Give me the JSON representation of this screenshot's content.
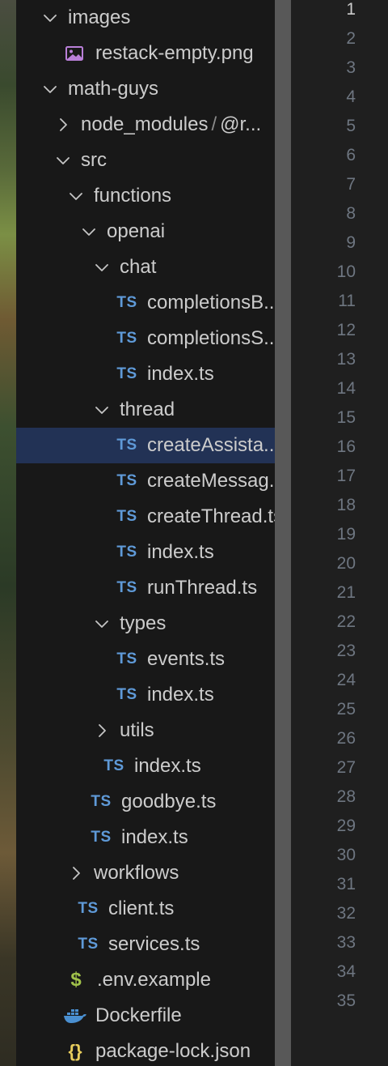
{
  "explorer": {
    "items": [
      {
        "label": "images",
        "kind": "folder",
        "expanded": true,
        "depth": 0,
        "icon": "chevron-down-icon"
      },
      {
        "label": "restack-empty.png",
        "kind": "image",
        "depth": 1,
        "icon": "image-file-icon"
      },
      {
        "label": "math-guys",
        "kind": "folder",
        "expanded": true,
        "depth": 0,
        "icon": "chevron-down-icon"
      },
      {
        "label": "node_modules",
        "label2": "@r...",
        "kind": "folder",
        "expanded": false,
        "depth": 1,
        "icon": "chevron-right-icon"
      },
      {
        "label": "src",
        "kind": "folder",
        "expanded": true,
        "depth": 1,
        "icon": "chevron-down-icon"
      },
      {
        "label": "functions",
        "kind": "folder",
        "expanded": true,
        "depth": 2,
        "icon": "chevron-down-icon"
      },
      {
        "label": "openai",
        "kind": "folder",
        "expanded": true,
        "depth": 3,
        "icon": "chevron-down-icon"
      },
      {
        "label": "chat",
        "kind": "folder",
        "expanded": true,
        "depth": 4,
        "icon": "chevron-down-icon"
      },
      {
        "label": "completionsB...",
        "kind": "ts",
        "depth": 5,
        "icon": "typescript-file-icon"
      },
      {
        "label": "completionsS...",
        "kind": "ts",
        "depth": 5,
        "icon": "typescript-file-icon"
      },
      {
        "label": "index.ts",
        "kind": "ts",
        "depth": 5,
        "icon": "typescript-file-icon"
      },
      {
        "label": "thread",
        "kind": "folder",
        "expanded": true,
        "depth": 4,
        "icon": "chevron-down-icon"
      },
      {
        "label": "createAssista...",
        "kind": "ts",
        "depth": 5,
        "selected": true,
        "icon": "typescript-file-icon"
      },
      {
        "label": "createMessag...",
        "kind": "ts",
        "depth": 5,
        "icon": "typescript-file-icon"
      },
      {
        "label": "createThread.ts",
        "kind": "ts",
        "depth": 5,
        "icon": "typescript-file-icon"
      },
      {
        "label": "index.ts",
        "kind": "ts",
        "depth": 5,
        "icon": "typescript-file-icon"
      },
      {
        "label": "runThread.ts",
        "kind": "ts",
        "depth": 5,
        "icon": "typescript-file-icon"
      },
      {
        "label": "types",
        "kind": "folder",
        "expanded": true,
        "depth": 4,
        "icon": "chevron-down-icon"
      },
      {
        "label": "events.ts",
        "kind": "ts",
        "depth": 5,
        "icon": "typescript-file-icon"
      },
      {
        "label": "index.ts",
        "kind": "ts",
        "depth": 5,
        "icon": "typescript-file-icon"
      },
      {
        "label": "utils",
        "kind": "folder",
        "expanded": false,
        "depth": 4,
        "icon": "chevron-right-icon"
      },
      {
        "label": "index.ts",
        "kind": "ts",
        "depth": 4,
        "icon": "typescript-file-icon"
      },
      {
        "label": "goodbye.ts",
        "kind": "ts",
        "depth": 3,
        "icon": "typescript-file-icon"
      },
      {
        "label": "index.ts",
        "kind": "ts",
        "depth": 3,
        "icon": "typescript-file-icon"
      },
      {
        "label": "workflows",
        "kind": "folder",
        "expanded": false,
        "depth": 2,
        "icon": "chevron-right-icon"
      },
      {
        "label": "client.ts",
        "kind": "ts",
        "depth": 2,
        "icon": "typescript-file-icon"
      },
      {
        "label": "services.ts",
        "kind": "ts",
        "depth": 2,
        "icon": "typescript-file-icon"
      },
      {
        "label": ".env.example",
        "kind": "env",
        "depth": 1,
        "icon": "dollar-env-icon"
      },
      {
        "label": "Dockerfile",
        "kind": "docker",
        "depth": 1,
        "icon": "docker-icon"
      },
      {
        "label": "package-lock.json",
        "kind": "json",
        "depth": 1,
        "icon": "json-braces-icon"
      }
    ],
    "ts_badge": "TS",
    "dollar_glyph": "$",
    "braces_glyph": "{}",
    "separator": "/"
  },
  "editor": {
    "line_numbers": [
      "1",
      "2",
      "3",
      "4",
      "5",
      "6",
      "7",
      "8",
      "9",
      "10",
      "11",
      "12",
      "13",
      "14",
      "15",
      "16",
      "17",
      "18",
      "19",
      "20",
      "21",
      "22",
      "23",
      "24",
      "25",
      "26",
      "27",
      "28",
      "29",
      "30",
      "31",
      "32",
      "33",
      "34",
      "35"
    ],
    "active_line": "1"
  },
  "colors": {
    "explorer_bg": "#181818",
    "selection_bg": "#223255",
    "ts_icon": "#5f9ad8",
    "env_icon": "#a1c24a",
    "json_icon": "#e8cd5c",
    "docker_icon": "#4a8fd0",
    "image_icon": "#b97fd8",
    "text": "#cccccc",
    "line_number": "#6e7681"
  }
}
